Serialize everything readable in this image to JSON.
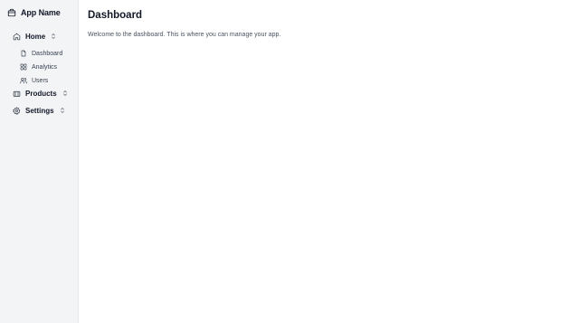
{
  "sidebar": {
    "app_name": "App Name",
    "items": [
      {
        "label": "Home"
      },
      {
        "label": "Products"
      },
      {
        "label": "Settings"
      }
    ],
    "home_subitems": [
      {
        "label": "Dashboard"
      },
      {
        "label": "Analytics"
      },
      {
        "label": "Users"
      }
    ]
  },
  "main": {
    "title": "Dashboard",
    "description": "Welcome to the dashboard. This is where you can manage your app."
  },
  "icons": {
    "brand": "briefcase-icon",
    "home": "home-icon",
    "dashboard": "file-icon",
    "analytics": "grid-icon",
    "users": "users-icon",
    "products": "box-icon",
    "settings": "gear-icon",
    "expand": "chevron-up-down-icon"
  },
  "colors": {
    "sidebar_bg": "#f3f4f6",
    "text_primary": "#111827",
    "text_secondary": "#4b5563"
  }
}
